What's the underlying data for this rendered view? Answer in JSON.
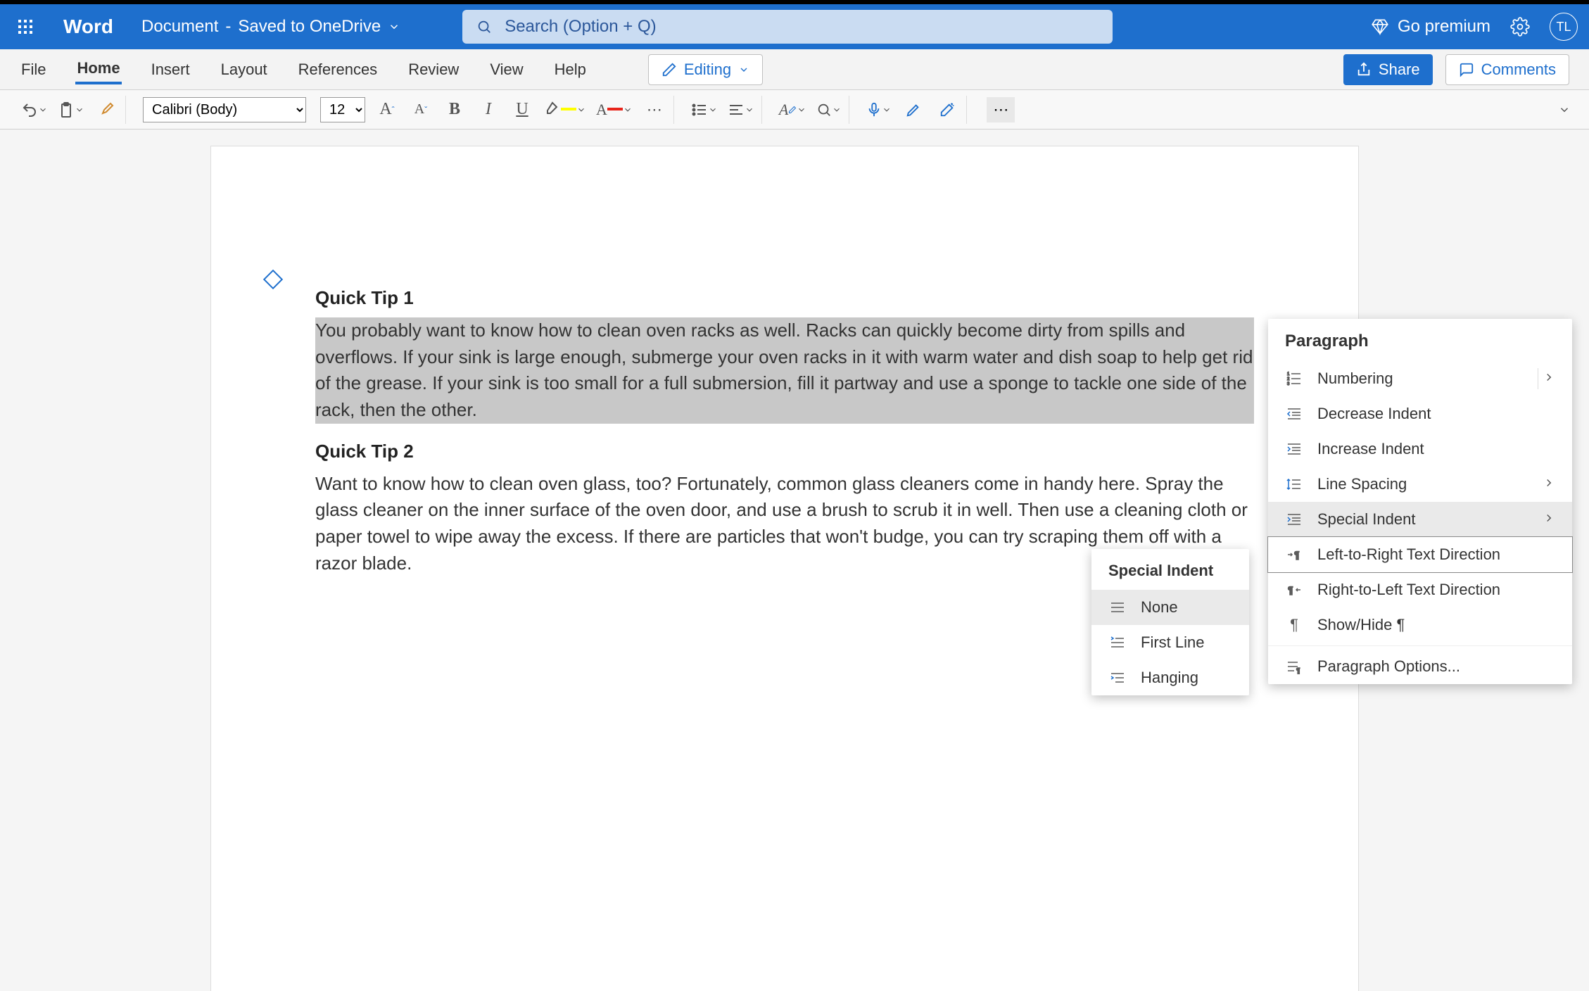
{
  "titlebar": {
    "app_name": "Word",
    "doc_name": "Document",
    "saved_status": "Saved to OneDrive",
    "search_placeholder": "Search (Option + Q)",
    "go_premium": "Go premium",
    "avatar_initials": "TL"
  },
  "ribbon": {
    "tabs": [
      "File",
      "Home",
      "Insert",
      "Layout",
      "References",
      "Review",
      "View",
      "Help"
    ],
    "active_tab": "Home",
    "editing_label": "Editing",
    "share_label": "Share",
    "comments_label": "Comments"
  },
  "toolbar": {
    "font_name": "Calibri (Body)",
    "font_size": "12"
  },
  "document": {
    "heading1": "Quick Tip 1",
    "para1": "You probably want to know how to clean oven racks as well. Racks can quickly become dirty from spills and overflows. If your sink is large enough, submerge your oven racks in it with warm water and dish soap to help get rid of the grease. If your sink is too small for a full submersion, fill it partway and use a sponge to tackle one side of the rack, then the other.",
    "heading2": "Quick Tip 2",
    "para2": "Want to know how to clean oven glass, too? Fortunately, common glass cleaners come in handy here. Spray the glass cleaner on the inner surface of the oven door, and use a brush to scrub it in well. Then use a cleaning cloth or paper towel to wipe away the excess. If there are particles that won't budge, you can try scraping them off with a razor blade."
  },
  "paragraph_menu": {
    "title": "Paragraph",
    "items": [
      {
        "label": "Numbering",
        "has_sub": true
      },
      {
        "label": "Decrease Indent",
        "has_sub": false
      },
      {
        "label": "Increase Indent",
        "has_sub": false
      },
      {
        "label": "Line Spacing",
        "has_sub": true
      },
      {
        "label": "Special Indent",
        "has_sub": true,
        "highlight": true
      },
      {
        "label": "Left-to-Right Text Direction",
        "has_sub": false,
        "boxed": true
      },
      {
        "label": "Right-to-Left Text Direction",
        "has_sub": false
      },
      {
        "label": "Show/Hide ¶",
        "has_sub": false
      },
      {
        "label": "Paragraph Options...",
        "has_sub": false
      }
    ]
  },
  "indent_submenu": {
    "title": "Special Indent",
    "items": [
      {
        "label": "None",
        "highlight": true
      },
      {
        "label": "First Line"
      },
      {
        "label": "Hanging"
      }
    ]
  }
}
